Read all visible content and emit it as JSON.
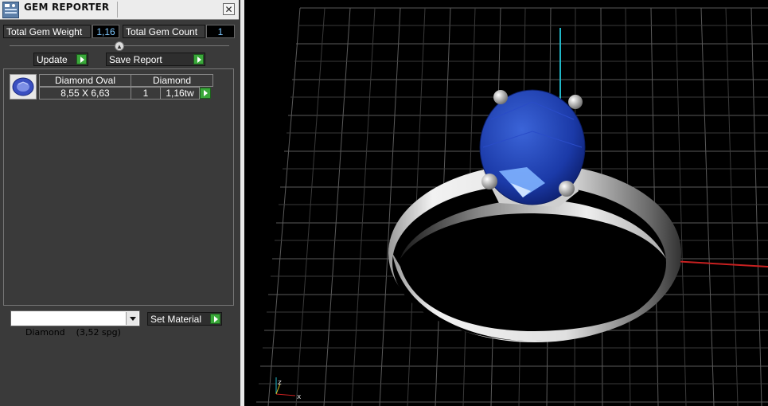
{
  "panel": {
    "title": "GEM REPORTER",
    "close_glyph": "✕",
    "total_gem_weight_label": "Total Gem Weight",
    "total_gem_weight_value": "1,16",
    "total_gem_count_label": "Total Gem Count",
    "total_gem_count_value": "1",
    "update_label": "Update",
    "save_report_label": "Save Report",
    "gem_list": {
      "headers": [
        "Diamond Oval",
        "Diamond"
      ],
      "rows": [
        {
          "size": "8,55 X 6,63",
          "count": "1",
          "weight": "1,16tw"
        }
      ]
    },
    "material_select": "Diamond    (3,52 spg)",
    "set_material_label": "Set Material"
  },
  "viewport": {
    "axis_labels": {
      "z": "z",
      "x": "x"
    },
    "colors": {
      "gem": "#1a3fae",
      "metal": "#d9d9d9",
      "x_axis": "#c82020",
      "y_axis": "#20b8c8",
      "grid": "#5a5a5a"
    }
  }
}
